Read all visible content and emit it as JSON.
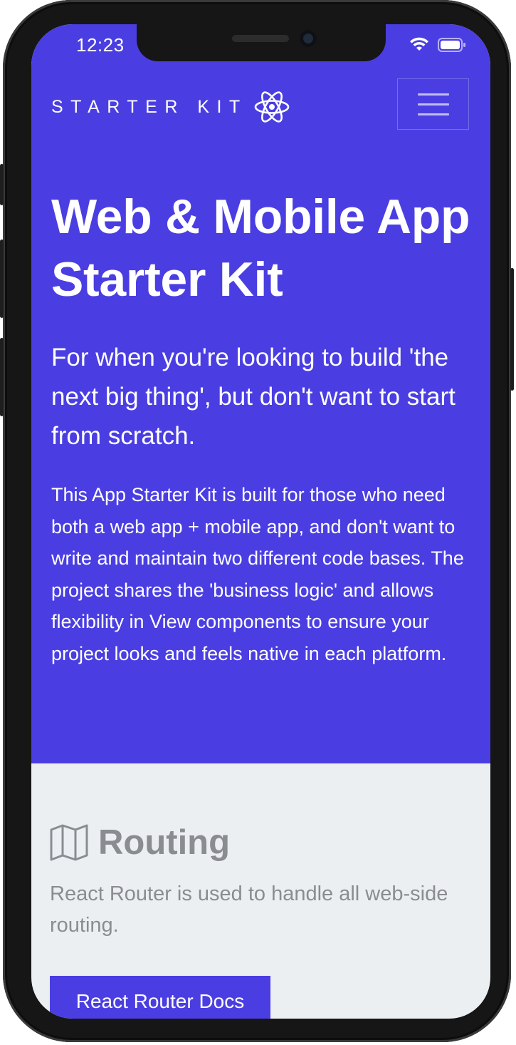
{
  "status_bar": {
    "time": "12:23",
    "wifi_icon": "wifi-icon",
    "battery_icon": "battery-icon"
  },
  "navbar": {
    "brand_text": "STARTER KIT",
    "brand_logo_icon": "react-atom-icon",
    "menu_icon": "hamburger-menu-icon"
  },
  "hero": {
    "title": "Web & Mobile App Starter Kit",
    "subtitle": "For when you're looking to build 'the next big thing', but don't want to start from scratch.",
    "body": "This App Starter Kit is built for those who need both a web app + mobile app, and don't want to write and maintain two different code bases. The project shares the 'business logic' and allows flexibility in View components to ensure your project looks and feels native in each platform."
  },
  "routing_section": {
    "icon": "map-icon",
    "title": "Routing",
    "text": "React Router is used to handle all web-side routing.",
    "button_label": "React Router Docs"
  },
  "colors": {
    "primary": "#4a3ee2",
    "section_bg": "#eceff2",
    "muted_text": "#8a8c91",
    "phone_frame": "#161616"
  }
}
